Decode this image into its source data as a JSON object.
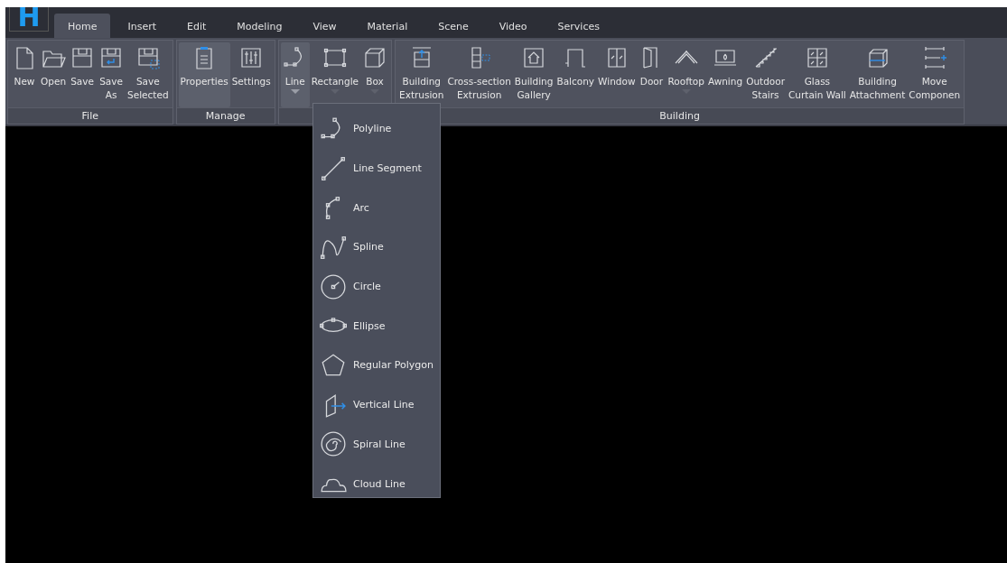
{
  "logo": "H",
  "tabs": [
    {
      "label": "Home",
      "selected": true
    },
    {
      "label": "Insert",
      "selected": false
    },
    {
      "label": "Edit",
      "selected": false
    },
    {
      "label": "Modeling",
      "selected": false
    },
    {
      "label": "View",
      "selected": false
    },
    {
      "label": "Material",
      "selected": false
    },
    {
      "label": "Scene",
      "selected": false
    },
    {
      "label": "Video",
      "selected": false
    },
    {
      "label": "Services",
      "selected": false
    }
  ],
  "ribbon": {
    "groups": [
      {
        "label": "File",
        "buttons": [
          {
            "lines": [
              "New"
            ],
            "pressed": false,
            "dropdown": false
          },
          {
            "lines": [
              "Open"
            ],
            "pressed": false,
            "dropdown": false
          },
          {
            "lines": [
              "Save"
            ],
            "pressed": false,
            "dropdown": false
          },
          {
            "lines": [
              "Save",
              "As"
            ],
            "pressed": false,
            "dropdown": false
          },
          {
            "lines": [
              "Save",
              "Selected"
            ],
            "pressed": false,
            "dropdown": false
          }
        ]
      },
      {
        "label": "Manage",
        "buttons": [
          {
            "lines": [
              "Properties"
            ],
            "pressed": true,
            "dropdown": false
          },
          {
            "lines": [
              "Settings"
            ],
            "pressed": false,
            "dropdown": false
          }
        ]
      },
      {
        "buttons": [
          {
            "lines": [
              "Line"
            ],
            "pressed": true,
            "dropdown": true
          },
          {
            "lines": [
              "Rectangle"
            ],
            "pressed": false,
            "dropdown": true
          },
          {
            "lines": [
              "Box"
            ],
            "pressed": false,
            "dropdown": true
          }
        ]
      },
      {
        "label": "Building",
        "buttons": [
          {
            "lines": [
              "Building",
              "Extrusion"
            ],
            "pressed": false,
            "dropdown": false
          },
          {
            "lines": [
              "Cross-section",
              "Extrusion"
            ],
            "pressed": false,
            "dropdown": false
          },
          {
            "lines": [
              "Building",
              "Gallery"
            ],
            "pressed": false,
            "dropdown": false
          },
          {
            "lines": [
              "Balcony"
            ],
            "pressed": false,
            "dropdown": false
          },
          {
            "lines": [
              "Window"
            ],
            "pressed": false,
            "dropdown": false
          },
          {
            "lines": [
              "Door"
            ],
            "pressed": false,
            "dropdown": false
          },
          {
            "lines": [
              "Rooftop"
            ],
            "pressed": false,
            "dropdown": true
          },
          {
            "lines": [
              "Awning"
            ],
            "pressed": false,
            "dropdown": false
          },
          {
            "lines": [
              "Outdoor",
              "Stairs"
            ],
            "pressed": false,
            "dropdown": false
          },
          {
            "lines": [
              "Glass",
              "Curtain Wall"
            ],
            "pressed": false,
            "dropdown": false
          },
          {
            "lines": [
              "Building",
              "Attachment"
            ],
            "pressed": false,
            "dropdown": false
          },
          {
            "lines": [
              "Move",
              "Componen"
            ],
            "pressed": false,
            "dropdown": false
          }
        ]
      }
    ]
  },
  "line_menu": {
    "items": [
      {
        "label": "Polyline"
      },
      {
        "label": "Line Segment"
      },
      {
        "label": "Arc"
      },
      {
        "label": "Spline"
      },
      {
        "label": "Circle"
      },
      {
        "label": "Ellipse"
      },
      {
        "label": "Regular Polygon"
      },
      {
        "label": "Vertical Line"
      },
      {
        "label": "Spiral Line"
      },
      {
        "label": "Cloud Line"
      }
    ]
  }
}
